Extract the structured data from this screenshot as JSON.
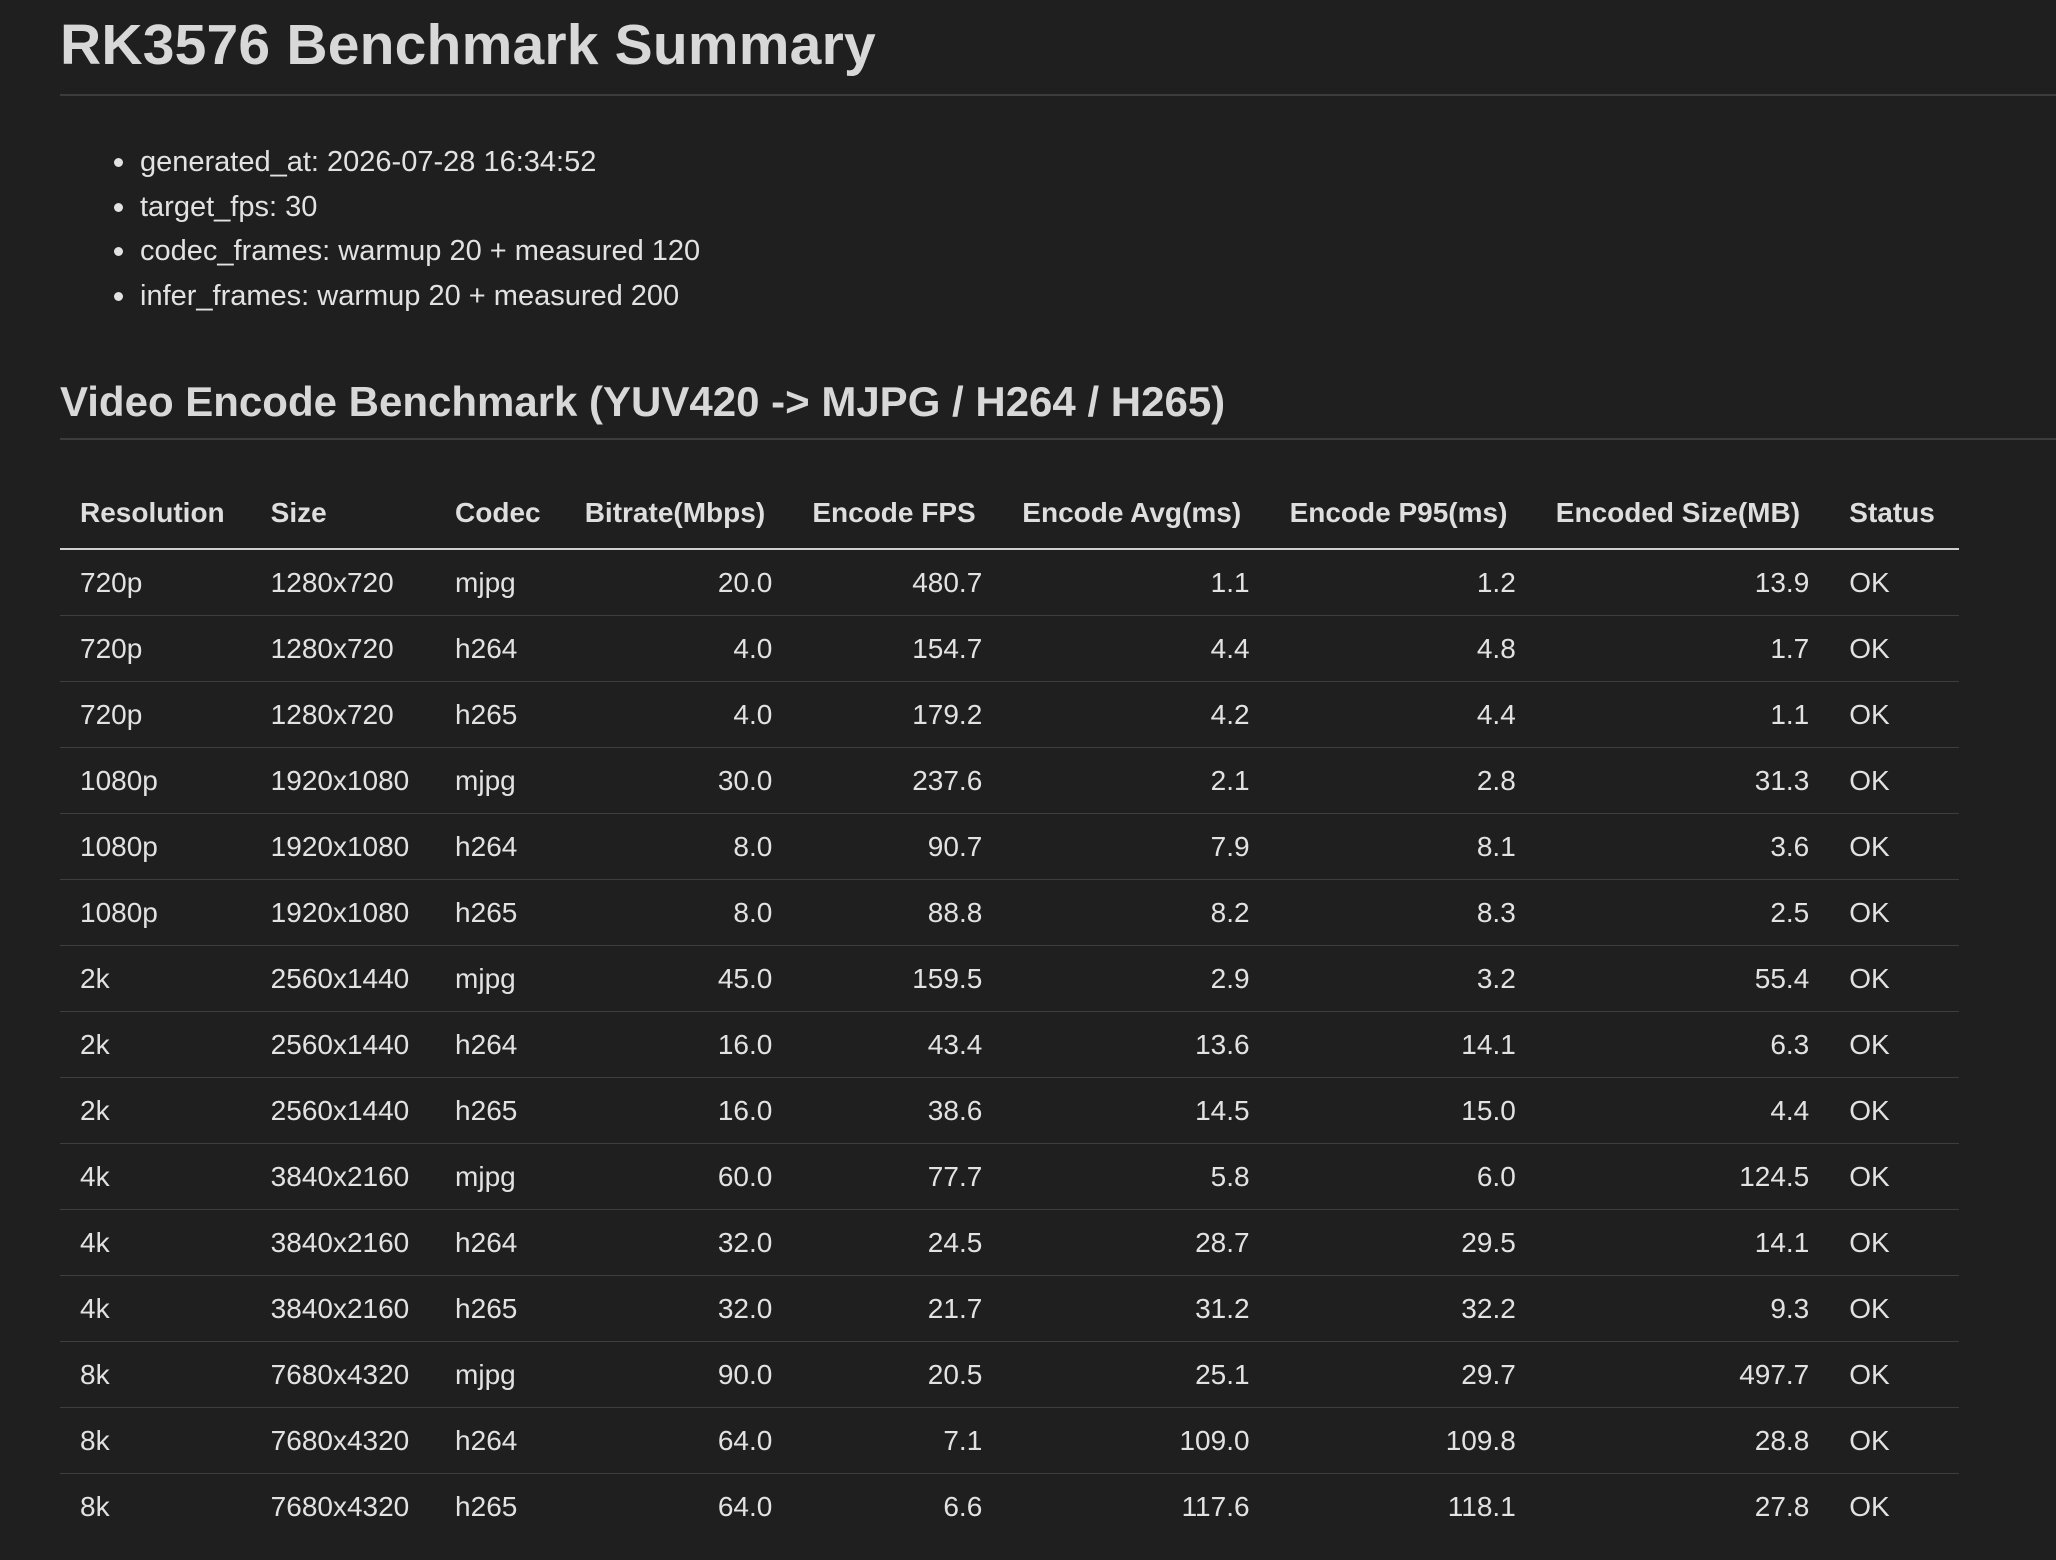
{
  "title": "RK3576 Benchmark Summary",
  "meta": [
    "generated_at: 2026-07-28 16:34:52",
    "target_fps: 30",
    "codec_frames: warmup 20 + measured 120",
    "infer_frames: warmup 20 + measured 200"
  ],
  "section_title": "Video Encode Benchmark (YUV420 -> MJPG / H264 / H265)",
  "table": {
    "headers": [
      "Resolution",
      "Size",
      "Codec",
      "Bitrate(Mbps)",
      "Encode FPS",
      "Encode Avg(ms)",
      "Encode P95(ms)",
      "Encoded Size(MB)",
      "Status"
    ],
    "rows": [
      [
        "720p",
        "1280x720",
        "mjpg",
        "20.0",
        "480.7",
        "1.1",
        "1.2",
        "13.9",
        "OK"
      ],
      [
        "720p",
        "1280x720",
        "h264",
        "4.0",
        "154.7",
        "4.4",
        "4.8",
        "1.7",
        "OK"
      ],
      [
        "720p",
        "1280x720",
        "h265",
        "4.0",
        "179.2",
        "4.2",
        "4.4",
        "1.1",
        "OK"
      ],
      [
        "1080p",
        "1920x1080",
        "mjpg",
        "30.0",
        "237.6",
        "2.1",
        "2.8",
        "31.3",
        "OK"
      ],
      [
        "1080p",
        "1920x1080",
        "h264",
        "8.0",
        "90.7",
        "7.9",
        "8.1",
        "3.6",
        "OK"
      ],
      [
        "1080p",
        "1920x1080",
        "h265",
        "8.0",
        "88.8",
        "8.2",
        "8.3",
        "2.5",
        "OK"
      ],
      [
        "2k",
        "2560x1440",
        "mjpg",
        "45.0",
        "159.5",
        "2.9",
        "3.2",
        "55.4",
        "OK"
      ],
      [
        "2k",
        "2560x1440",
        "h264",
        "16.0",
        "43.4",
        "13.6",
        "14.1",
        "6.3",
        "OK"
      ],
      [
        "2k",
        "2560x1440",
        "h265",
        "16.0",
        "38.6",
        "14.5",
        "15.0",
        "4.4",
        "OK"
      ],
      [
        "4k",
        "3840x2160",
        "mjpg",
        "60.0",
        "77.7",
        "5.8",
        "6.0",
        "124.5",
        "OK"
      ],
      [
        "4k",
        "3840x2160",
        "h264",
        "32.0",
        "24.5",
        "28.7",
        "29.5",
        "14.1",
        "OK"
      ],
      [
        "4k",
        "3840x2160",
        "h265",
        "32.0",
        "21.7",
        "31.2",
        "32.2",
        "9.3",
        "OK"
      ],
      [
        "8k",
        "7680x4320",
        "mjpg",
        "90.0",
        "20.5",
        "25.1",
        "29.7",
        "497.7",
        "OK"
      ],
      [
        "8k",
        "7680x4320",
        "h264",
        "64.0",
        "7.1",
        "109.0",
        "109.8",
        "28.8",
        "OK"
      ],
      [
        "8k",
        "7680x4320",
        "h265",
        "64.0",
        "6.6",
        "117.6",
        "118.1",
        "27.8",
        "OK"
      ]
    ]
  }
}
